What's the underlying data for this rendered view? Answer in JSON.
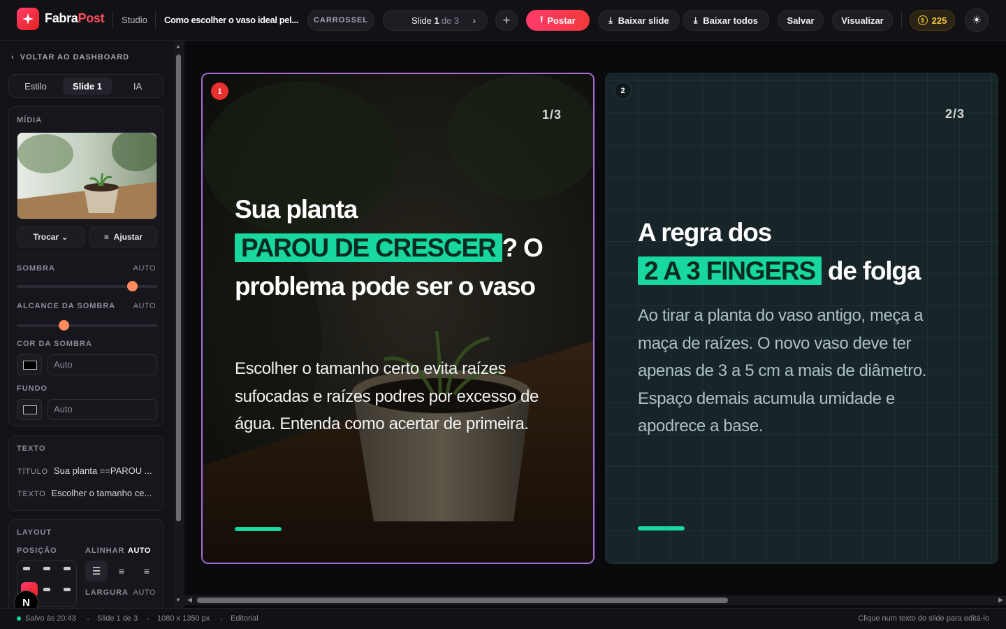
{
  "app": {
    "brand_part1": "Fabra",
    "brand_part2": "Post",
    "section": "Studio",
    "document_title": "Como escolher o vaso ideal pel...",
    "type_tag": "CARROSSEL"
  },
  "slide_nav": {
    "prefix": "Slide",
    "current": "1",
    "of_label": "de 3",
    "next_icon": "chevron-right-icon"
  },
  "toolbar": {
    "add_label": "+",
    "post_label": "Postar",
    "download_slide_label": "Baixar slide",
    "download_all_label": "Baixar todos",
    "save_label": "Salvar",
    "preview_label": "Visualizar",
    "credits": "225",
    "theme_icon": "sun-icon"
  },
  "sidebar": {
    "back_label": "VOLTAR AO DASHBOARD",
    "tabs": [
      "Estilo",
      "Slide 1",
      "IA"
    ],
    "active_tab": "Slide 1",
    "media": {
      "label": "MÍDIA",
      "swap_label": "Trocar",
      "adjust_label": "Ajustar"
    },
    "shadow": {
      "label": "SOMBRA",
      "mode": "AUTO",
      "value": 0.85
    },
    "shadow_reach": {
      "label": "ALCANCE DA SOMBRA",
      "mode": "AUTO",
      "value": 0.32
    },
    "shadow_color": {
      "label": "COR DA SOMBRA",
      "value": "Auto"
    },
    "background": {
      "label": "FUNDO",
      "value": "Auto"
    },
    "text": {
      "label": "TEXTO",
      "title_key": "TÍTULO",
      "title_value": "Sua planta ==PAROU ...",
      "body_key": "TEXTO",
      "body_value": "Escolher o tamanho ce..."
    },
    "layout": {
      "label": "LAYOUT",
      "position_label": "POSIÇÃO",
      "align_label": "ALINHAR",
      "align_mode": "AUTO",
      "width_label": "LARGURA",
      "width_mode": "AUTO"
    },
    "corner_badge": "N"
  },
  "slides": [
    {
      "badge": "1",
      "counter": "1/3",
      "title_before": "Sua planta",
      "title_highlight": "PAROU DE CRESCER",
      "title_after": "? O problema pode ser o vaso",
      "body": "Escolher o tamanho certo evita raízes sufocadas e raízes podres por excesso de água. Entenda como acertar de primeira."
    },
    {
      "badge": "2",
      "counter": "2/3",
      "title_before": "A regra dos",
      "title_highlight": "2 A 3 FINGERS",
      "title_after": "de folga",
      "body": "Ao tirar a planta do vaso antigo, meça a maça de raízes. O novo vaso deve ter apenas de 3 a 5 cm a mais de diâmetro. Espaço demais acumula umidade e apodrece a base."
    }
  ],
  "status": {
    "saved": "Salvo às 20:43",
    "slide": "Slide 1 de 3",
    "size": "1080 x 1350 px",
    "style": "Editorial",
    "hint": "Clique num texto do slide para editá-lo"
  },
  "colors": {
    "accent": "#18d79f",
    "brand": "#ff3b6b",
    "selection": "#a66dd4"
  }
}
